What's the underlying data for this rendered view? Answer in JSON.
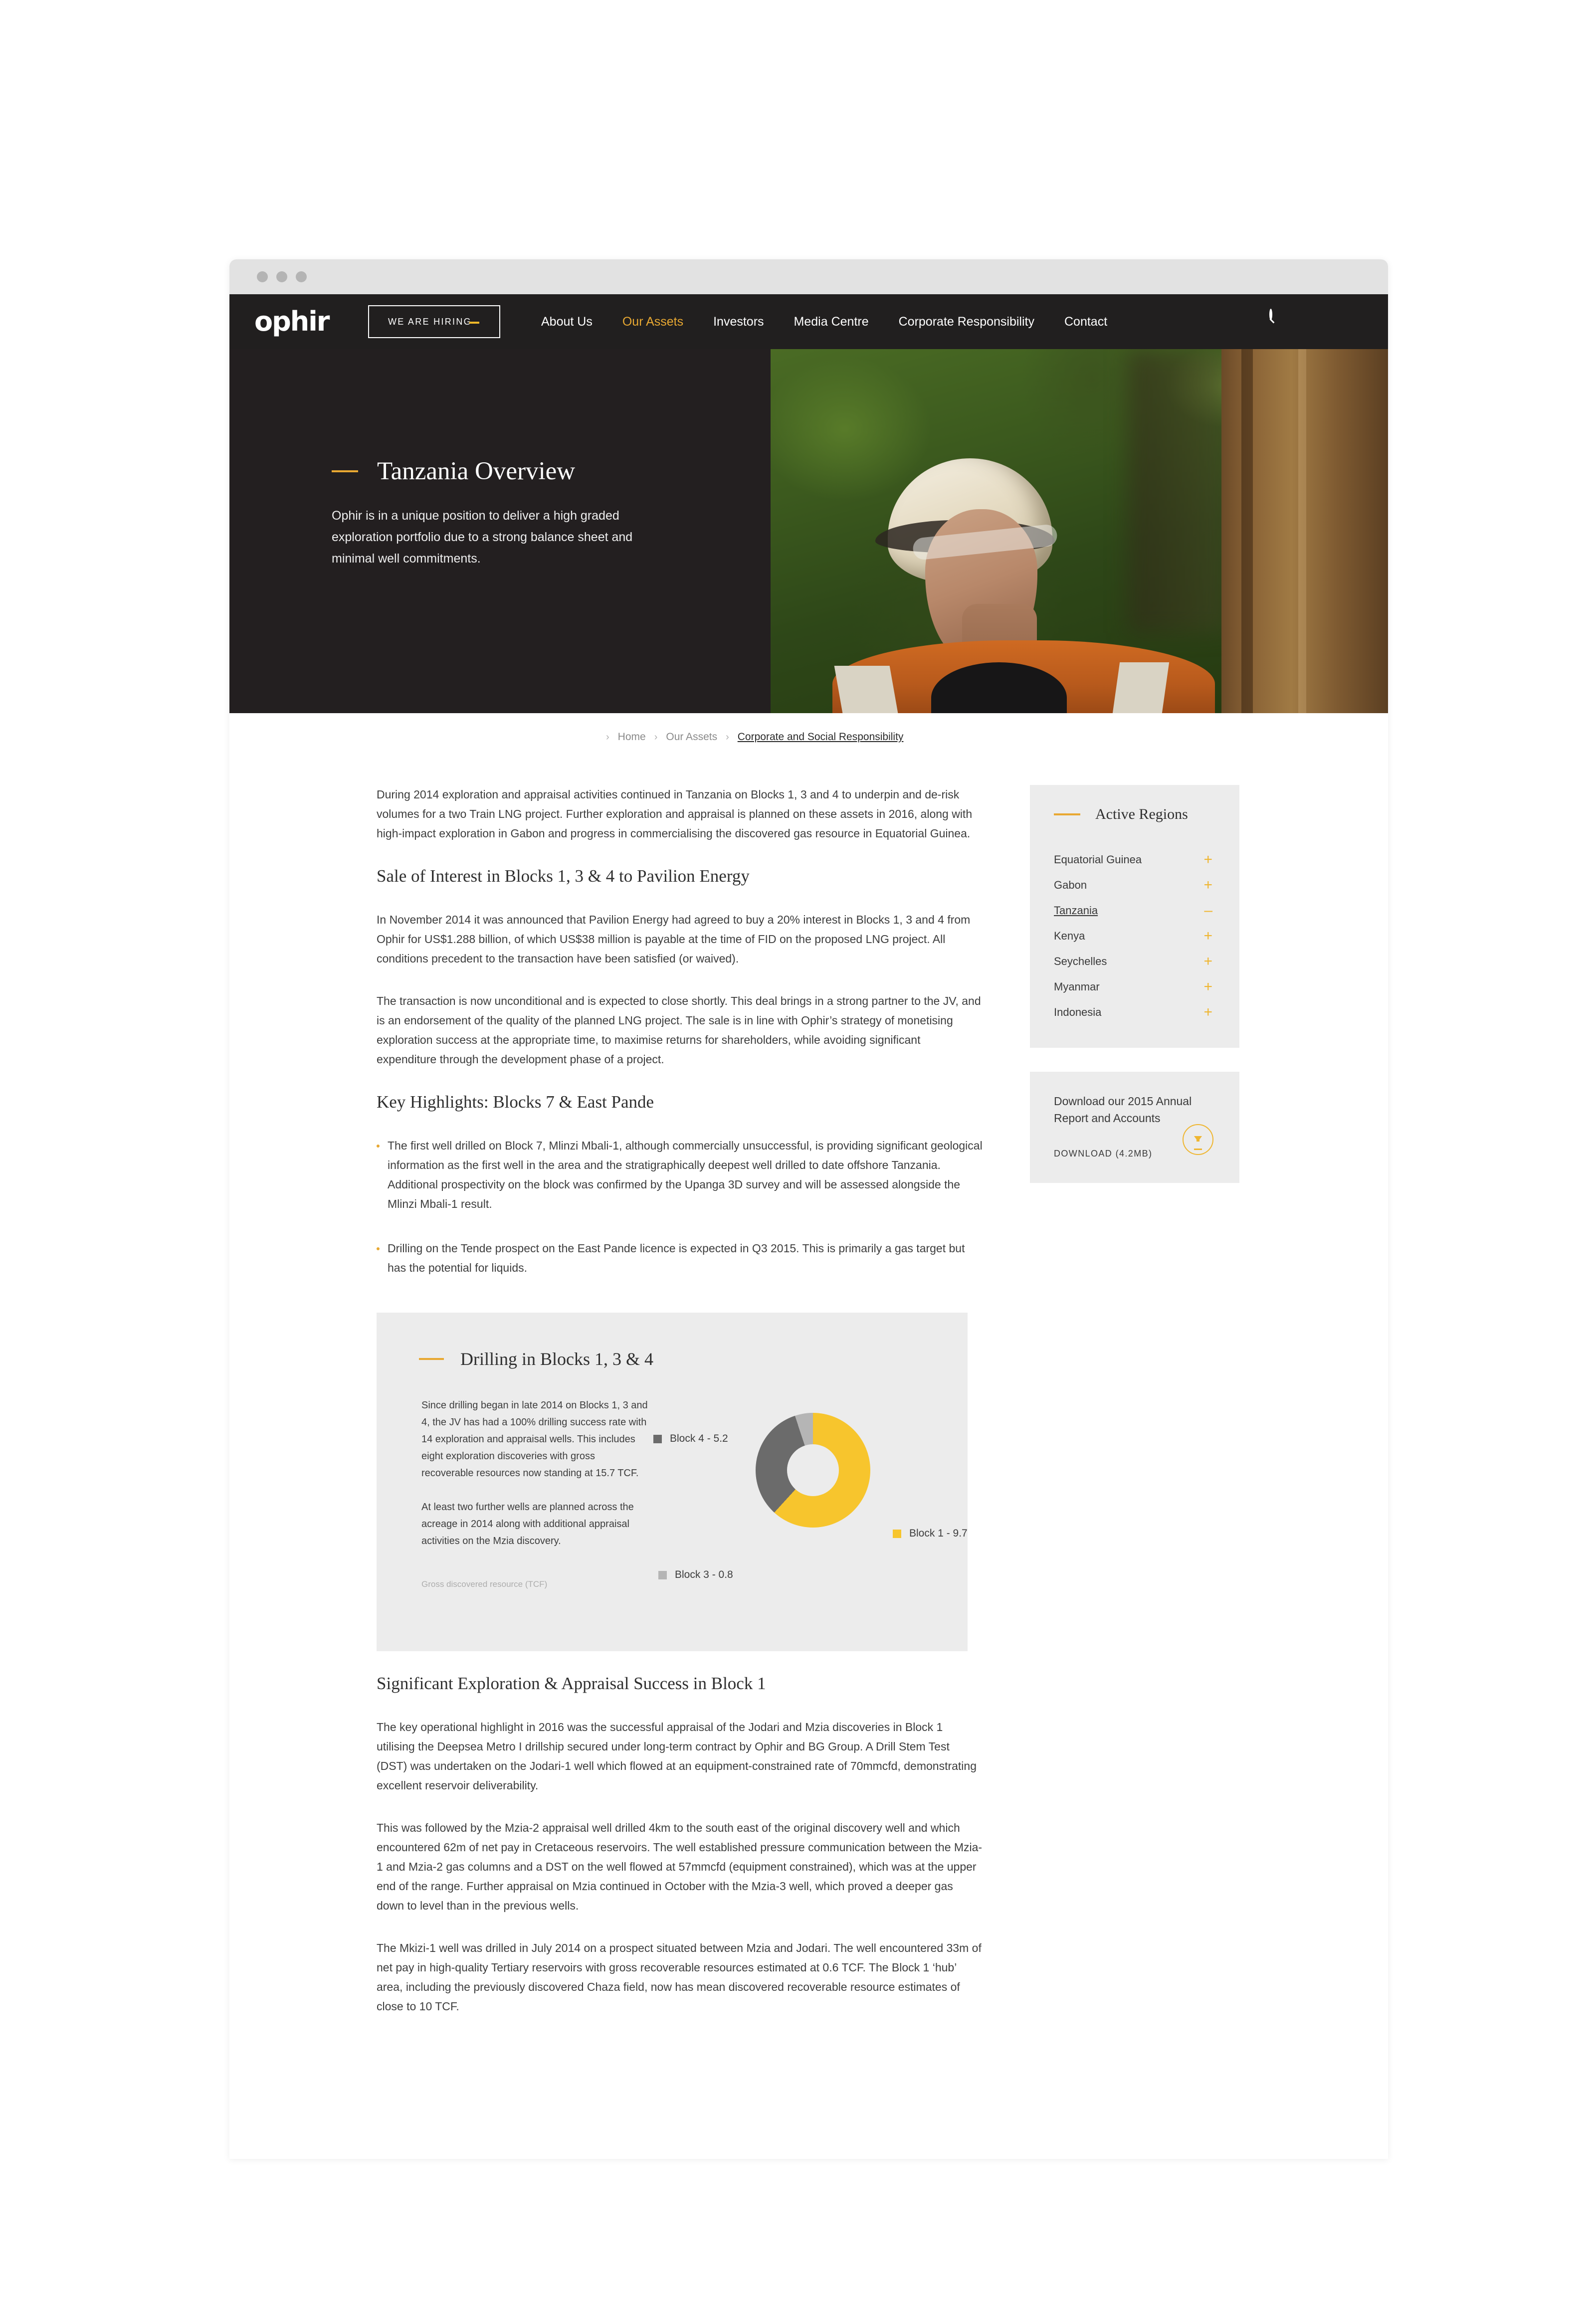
{
  "browser": {
    "dots": 3
  },
  "header": {
    "logo_text": "ophir",
    "hiring_label": "WE ARE HIRING",
    "nav": [
      {
        "label": "About Us",
        "active": false
      },
      {
        "label": "Our Assets",
        "active": true
      },
      {
        "label": "Investors",
        "active": false
      },
      {
        "label": "Media Centre",
        "active": false
      },
      {
        "label": "Corporate Responsibility",
        "active": false
      },
      {
        "label": "Contact",
        "active": false
      }
    ],
    "search_icon": "search-icon"
  },
  "hero": {
    "title": "Tanzania Overview",
    "subtitle": "Ophir is in a unique position to deliver a high graded exploration portfolio due to a strong balance sheet and minimal well commitments."
  },
  "breadcrumb": {
    "items": [
      {
        "label": "Home",
        "current": false
      },
      {
        "label": "Our Assets",
        "current": false
      },
      {
        "label": "Corporate and Social Responsibility",
        "current": true
      }
    ],
    "separator": "›"
  },
  "main": {
    "intro": "During 2014 exploration and appraisal activities continued in Tanzania on Blocks 1, 3 and 4 to underpin and de-risk volumes for a two Train LNG project. Further exploration and appraisal is planned on these assets in 2016, along with high-impact exploration in Gabon and progress in commercialising the discovered gas resource in Equatorial Guinea.",
    "section1_heading": "Sale of Interest in Blocks 1, 3 & 4 to Pavilion Energy",
    "section1_p1": "In November 2014 it was announced that Pavilion Energy had agreed to buy a 20% interest in Blocks 1, 3 and 4 from Ophir for US$1.288 billion, of which US$38 million is payable at the time of FID on the proposed LNG project. All conditions precedent to the transaction have been satisfied (or waived).",
    "section1_p2": "The transaction is now unconditional and is expected to close shortly. This deal brings in a strong partner to the JV, and is an endorsement of the quality of the planned LNG project. The sale is in line with Ophir’s strategy of monetising exploration success at the appropriate time, to maximise returns for shareholders, while avoiding significant expenditure through the development phase of a project.",
    "section2_heading": "Key Highlights: Blocks 7 & East Pande",
    "bullets": [
      "The first well drilled on Block 7, Mlinzi Mbali-1, although commercially unsuccessful, is providing significant geological information as the first well in the area and the stratigraphically deepest well drilled to date offshore Tanzania. Additional prospectivity on the block was confirmed by the Upanga 3D survey and will be assessed alongside the Mlinzi Mbali-1 result.",
      "Drilling on the Tende prospect on the East Pande licence is expected in Q3 2015. This is primarily a gas target but has the potential for liquids."
    ],
    "section3_heading": "Significant Exploration & Appraisal Success in Block 1",
    "section3_p1": "The key operational highlight in 2016 was the successful appraisal of the Jodari and Mzia discoveries in Block 1 utilising the Deepsea Metro I drillship secured under long-term contract by Ophir and BG Group. A Drill Stem Test (DST) was undertaken on the Jodari-1 well which flowed at an equipment-constrained rate of 70mmcfd, demonstrating excellent reservoir deliverability.",
    "section3_p2": "This was followed by the Mzia-2 appraisal well drilled 4km to the south east of the original discovery well and which encountered 62m of net pay in Cretaceous reservoirs. The well established pressure communication between the Mzia-1 and Mzia-2 gas columns and a DST on the well flowed at 57mmcfd (equipment constrained), which was at the upper end of the range. Further appraisal on Mzia continued in October with the Mzia-3 well, which proved a deeper gas down to level than in the previous wells.",
    "section3_p3": "The Mkizi-1 well was drilled in July 2014 on a prospect situated between Mzia and Jodari. The well encountered 33m of net pay in high-quality Tertiary reservoirs with gross recoverable resources estimated at 0.6 TCF. The Block 1 ‘hub’ area, including the previously discovered Chaza field, now has mean discovered recoverable resource estimates of close to 10 TCF."
  },
  "chart_panel": {
    "title": "Drilling in Blocks 1, 3 & 4",
    "p1": "Since drilling began in late 2014 on Blocks 1, 3 and 4, the JV has had a 100% drilling success rate with 14 exploration and appraisal wells. This includes eight exploration discoveries with gross recoverable resources now standing at 15.7 TCF.",
    "p2": "At least two further wells are planned across the acreage in 2014 along with additional appraisal activities on the Mzia discovery.",
    "caption": "Gross discovered resource (TCF)"
  },
  "chart_data": {
    "type": "pie",
    "title": "Drilling in Blocks 1, 3 & 4",
    "subtitle": "Gross discovered resource (TCF)",
    "categories": [
      "Block 1",
      "Block 4",
      "Block 3"
    ],
    "values": [
      9.7,
      5.2,
      0.8
    ],
    "total": 15.7,
    "unit": "TCF",
    "donut": true,
    "legend_position": "around",
    "legend": [
      {
        "label": "Block 4  -  5.2",
        "value": 5.2,
        "color": "#6b6b6b"
      },
      {
        "label": "Block 3  -  0.8",
        "value": 0.8,
        "color": "#b5b5b5"
      },
      {
        "label": "Block 1  -  9.7",
        "value": 9.7,
        "color": "#f7c52d"
      }
    ]
  },
  "sidebar": {
    "regions_title": "Active Regions",
    "regions": [
      {
        "label": "Equatorial Guinea",
        "sign": "+",
        "selected": false
      },
      {
        "label": "Gabon",
        "sign": "+",
        "selected": false
      },
      {
        "label": "Tanzania",
        "sign": "–",
        "selected": true
      },
      {
        "label": "Kenya",
        "sign": "+",
        "selected": false
      },
      {
        "label": "Seychelles",
        "sign": "+",
        "selected": false
      },
      {
        "label": "Myanmar",
        "sign": "+",
        "selected": false
      },
      {
        "label": "Indonesia",
        "sign": "+",
        "selected": false
      }
    ],
    "download_title": "Download our 2015 Annual Report and Accounts",
    "download_link": "DOWNLOAD (4.2MB)",
    "download_icon": "download-icon"
  },
  "colors": {
    "accent": "#e8a832",
    "accent_bright": "#f7c52d",
    "dark": "#211f1f",
    "panel": "#ececec"
  }
}
